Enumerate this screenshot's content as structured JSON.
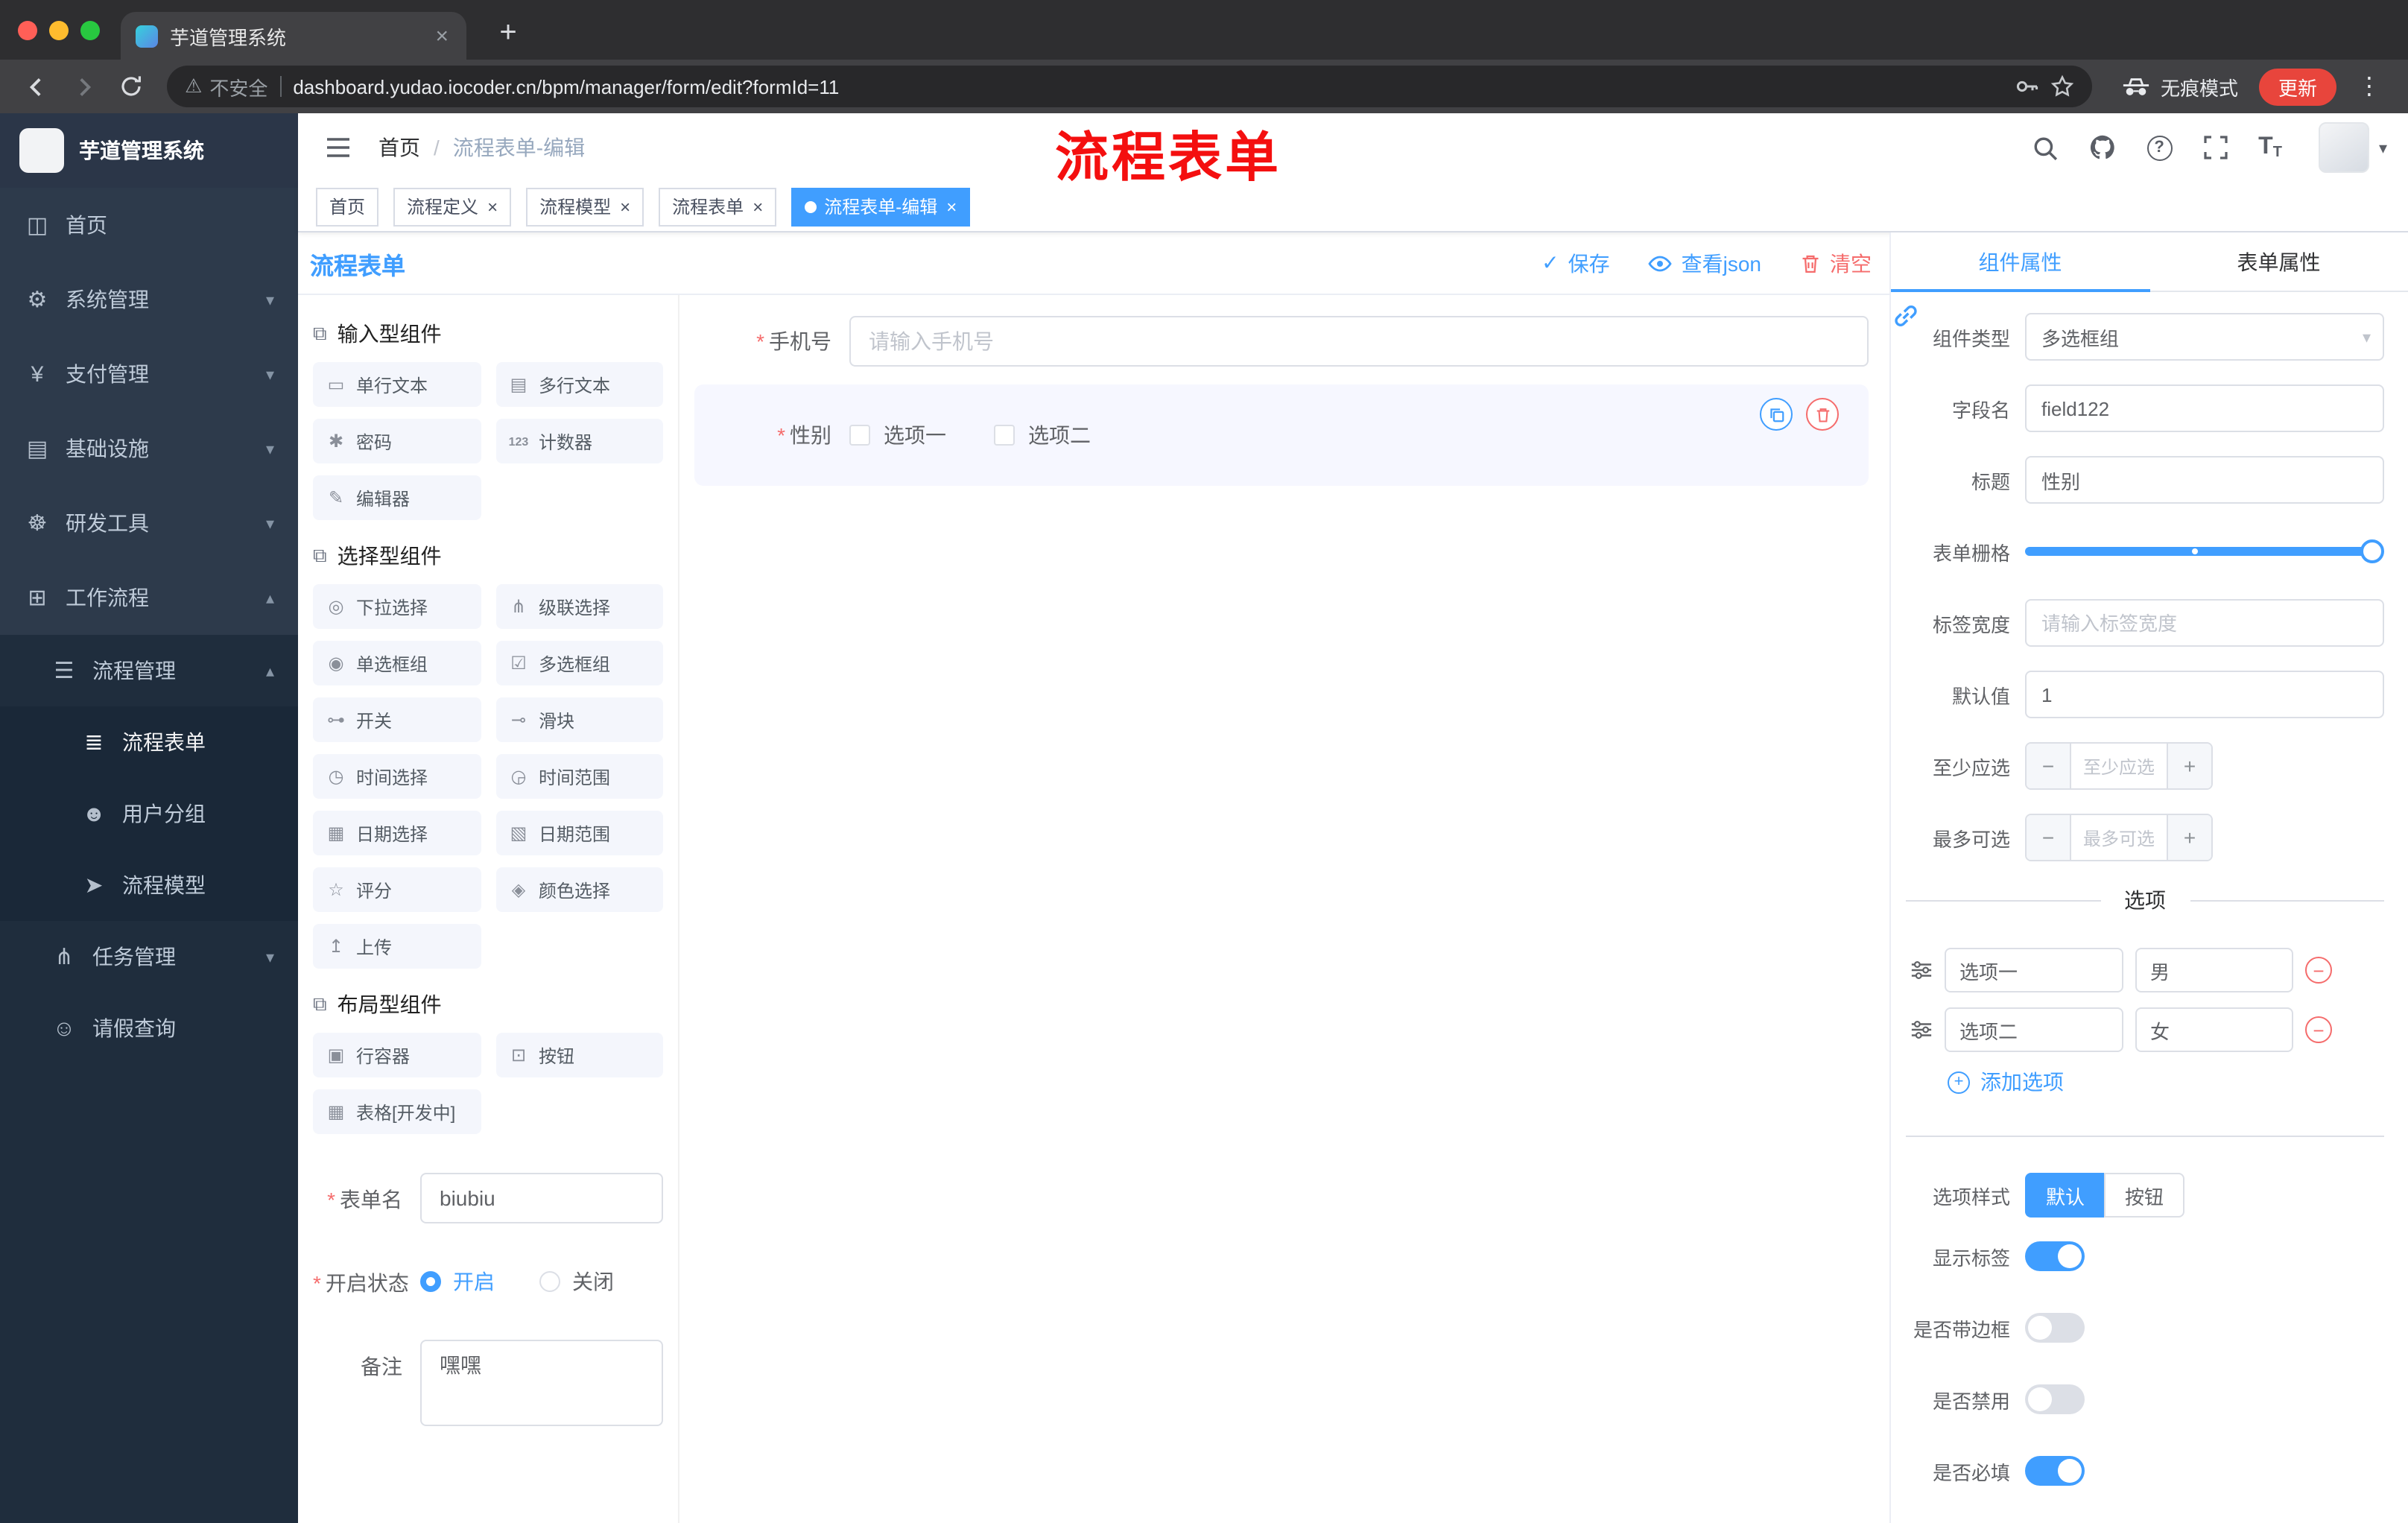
{
  "colors": {
    "accent": "#409eff",
    "danger": "#f56c6c",
    "annotation_red": "#f40f0f",
    "sidebar_dark": "#2d3a4b"
  },
  "icons": {
    "close": "×",
    "plus": "+",
    "kebab": "⋮",
    "caret_down": "▾",
    "caret_up": "▴",
    "check": "✓",
    "warning": "⚠",
    "minus": "−",
    "question": "?",
    "font_big": "T",
    "font_small": "T"
  },
  "browser": {
    "tab_title": "芋道管理系统",
    "security_label": "不安全",
    "url": "dashboard.yudao.iocoder.cn/bpm/manager/form/edit?formId=11",
    "incognito_label": "无痕模式",
    "update_label": "更新"
  },
  "annotation": "流程表单",
  "sidebar": {
    "logo_title": "芋道管理系统",
    "items": [
      {
        "label": "首页",
        "glyph": "◫"
      },
      {
        "label": "系统管理",
        "glyph": "⚙",
        "arrow": "▾"
      },
      {
        "label": "支付管理",
        "glyph": "¥",
        "arrow": "▾"
      },
      {
        "label": "基础设施",
        "glyph": "▤",
        "arrow": "▾"
      },
      {
        "label": "研发工具",
        "glyph": "☸",
        "arrow": "▾"
      },
      {
        "label": "工作流程",
        "glyph": "⊞",
        "arrow": "▴"
      },
      {
        "label": "流程管理",
        "glyph": "☰",
        "arrow": "▴"
      },
      {
        "label": "流程表单",
        "glyph": "≣"
      },
      {
        "label": "用户分组",
        "glyph": "☻"
      },
      {
        "label": "流程模型",
        "glyph": "➤"
      },
      {
        "label": "任务管理",
        "glyph": "⋔",
        "arrow": "▾"
      },
      {
        "label": "请假查询",
        "glyph": "☺"
      }
    ]
  },
  "navbar": {
    "breadcrumb": [
      "首页",
      "流程表单-编辑"
    ]
  },
  "tags": [
    {
      "label": "首页"
    },
    {
      "label": "流程定义"
    },
    {
      "label": "流程模型"
    },
    {
      "label": "流程表单"
    },
    {
      "label": "流程表单-编辑"
    }
  ],
  "editor": {
    "title": "流程表单",
    "save": "保存",
    "view_json": "查看json",
    "clear": "清空"
  },
  "palette": {
    "groups": [
      {
        "title": "输入型组件",
        "items": [
          {
            "label": "单行文本",
            "glyph": "▭"
          },
          {
            "label": "多行文本",
            "glyph": "▤"
          },
          {
            "label": "密码",
            "glyph": "✱"
          },
          {
            "label": "计数器",
            "glyph": "123"
          },
          {
            "label": "编辑器",
            "glyph": "✎"
          }
        ]
      },
      {
        "title": "选择型组件",
        "items": [
          {
            "label": "下拉选择",
            "glyph": "◎"
          },
          {
            "label": "级联选择",
            "glyph": "⋔"
          },
          {
            "label": "单选框组",
            "glyph": "◉"
          },
          {
            "label": "多选框组",
            "glyph": "☑"
          },
          {
            "label": "开关",
            "glyph": "⊶"
          },
          {
            "label": "滑块",
            "glyph": "⊸"
          },
          {
            "label": "时间选择",
            "glyph": "◷"
          },
          {
            "label": "时间范围",
            "glyph": "◶"
          },
          {
            "label": "日期选择",
            "glyph": "▦"
          },
          {
            "label": "日期范围",
            "glyph": "▧"
          },
          {
            "label": "评分",
            "glyph": "☆"
          },
          {
            "label": "颜色选择",
            "glyph": "◈"
          },
          {
            "label": "上传",
            "glyph": "↥"
          }
        ]
      },
      {
        "title": "布局型组件",
        "items": [
          {
            "label": "行容器",
            "glyph": "▣"
          },
          {
            "label": "按钮",
            "glyph": "⊡"
          },
          {
            "label": "表格[开发中]",
            "glyph": "▦"
          }
        ]
      }
    ]
  },
  "left_form": {
    "name_label": "表单名",
    "name_value": "biubiu",
    "status_label": "开启状态",
    "status_on": "开启",
    "status_off": "关闭",
    "remark_label": "备注",
    "remark_value": "嘿嘿"
  },
  "canvas": {
    "phone_label": "手机号",
    "phone_placeholder": "请输入手机号",
    "gender_label": "性别",
    "gender_options": [
      "选项一",
      "选项二"
    ]
  },
  "props": {
    "tab_component": "组件属性",
    "tab_form": "表单属性",
    "rows": {
      "component_type": {
        "label": "组件类型",
        "value": "多选框组"
      },
      "field_name": {
        "label": "字段名",
        "value": "field122"
      },
      "title": {
        "label": "标题",
        "value": "性别"
      },
      "grid": {
        "label": "表单栅格"
      },
      "label_width": {
        "label": "标签宽度",
        "placeholder": "请输入标签宽度"
      },
      "default_value": {
        "label": "默认值",
        "value": "1"
      },
      "min_checked": {
        "label": "至少应选",
        "placeholder": "至少应选"
      },
      "max_checked": {
        "label": "最多可选",
        "placeholder": "最多可选"
      }
    },
    "options_title": "选项",
    "options": [
      {
        "name": "选项一",
        "value": "男"
      },
      {
        "name": "选项二",
        "value": "女"
      }
    ],
    "add_option": "添加选项",
    "option_style": {
      "label": "选项样式",
      "choices": [
        "默认",
        "按钮"
      ],
      "selected": "默认"
    },
    "toggles": [
      {
        "label": "显示标签",
        "on": true
      },
      {
        "label": "是否带边框",
        "on": false
      },
      {
        "label": "是否禁用",
        "on": false
      },
      {
        "label": "是否必填",
        "on": true
      }
    ]
  }
}
